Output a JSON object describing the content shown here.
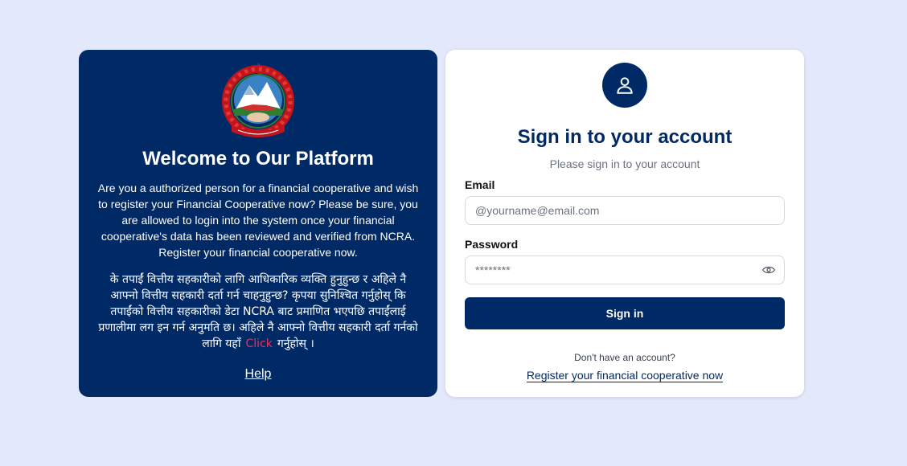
{
  "colors": {
    "page_background": "#e3e8fb",
    "brand_navy": "#002a66",
    "click_accent": "#e8335b"
  },
  "welcome": {
    "emblem_icon": "nepal-emblem-icon",
    "title": "Welcome to Our Platform",
    "body_en": "Are you a authorized person for a financial cooperative and wish to register your Financial Cooperative now? Please be sure, you are allowed to login into the system once your financial cooperative's data has been reviewed and verified from NCRA. Register your financial cooperative now.",
    "body_np_before": "के तपाईं वित्तीय सहकारीको लागि आधिकारिक व्यक्ति हुनुहुन्छ र अहिले नै आफ्नो वित्तीय सहकारी दर्ता गर्न चाहनुहुन्छ? कृपया सुनिश्चित गर्नुहोस् कि तपाईंको वित्तीय सहकारीको डेटा NCRA बाट प्रमाणित भएपछि तपाईंलाई प्रणालीमा लग इन गर्न अनुमति छ। अहिले नै आफ्नो वित्तीय सहकारी दर्ता गर्नको लागि यहाँ",
    "click_label": "Click",
    "body_np_after": "गर्नुहोस् ।",
    "help_label": "Help"
  },
  "signin": {
    "avatar_icon": "user-icon",
    "title": "Sign in to your account",
    "subtitle": "Please sign in to your account",
    "email_label": "Email",
    "email_placeholder": "@yourname@email.com",
    "email_value": "",
    "password_label": "Password",
    "password_placeholder": "********",
    "password_value": "",
    "password_toggle_icon": "eye-icon",
    "submit_label": "Sign in",
    "no_account_text": "Don't have an account?",
    "register_label": "Register your financial cooperative now"
  }
}
